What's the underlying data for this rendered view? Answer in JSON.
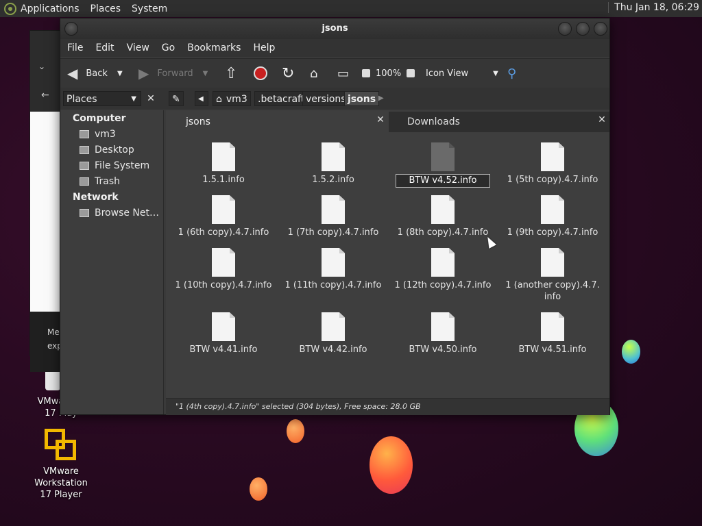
{
  "top_panel": {
    "menus": [
      "Applications",
      "Places",
      "System"
    ],
    "clock": "Thu Jan 18, 06:29"
  },
  "desktop": {
    "icons": [
      {
        "label_line1": "VMware W",
        "label_line2": "17 Play"
      },
      {
        "label_line1": "VMware Workstation",
        "label_line2": "17 Player"
      }
    ]
  },
  "background_window": {
    "text_line1": "Me",
    "text_line2": "exp"
  },
  "window": {
    "title": "jsons",
    "menu": [
      "File",
      "Edit",
      "View",
      "Go",
      "Bookmarks",
      "Help"
    ],
    "toolbar": {
      "back": "Back",
      "forward": "Forward",
      "zoom": "100%",
      "view_mode": "Icon View"
    },
    "places_combo": "Places",
    "breadcrumbs": [
      "vm3",
      ".betacraft",
      "versions",
      "jsons"
    ],
    "sidebar": {
      "computer_header": "Computer",
      "computer_items": [
        "vm3",
        "Desktop",
        "File System",
        "Trash"
      ],
      "network_header": "Network",
      "network_items": [
        "Browse Net…"
      ]
    },
    "tabs": [
      "jsons",
      "Downloads"
    ],
    "files": [
      "1.5.1.info",
      "1.5.2.info",
      "BTW v4.52.info",
      "1 (5th copy).4.7.info",
      "1 (6th copy).4.7.info",
      "1 (7th copy).4.7.info",
      "1 (8th copy).4.7.info",
      "1 (9th copy).4.7.info",
      "1 (10th copy).4.7.info",
      "1 (11th copy).4.7.info",
      "1 (12th copy).4.7.info",
      "1 (another copy).4.7.\ninfo",
      "BTW v4.41.info",
      "BTW v4.42.info",
      "BTW v4.50.info",
      "BTW v4.51.info"
    ],
    "renaming_file_index": 2,
    "status": "\"1 (4th copy).4.7.info\" selected (304 bytes), Free space: 28.0 GB"
  },
  "colors": {
    "accent_yellow": "#f2b800",
    "panel_bg": "#2f2f2f",
    "window_bg": "#3a3a3a"
  }
}
